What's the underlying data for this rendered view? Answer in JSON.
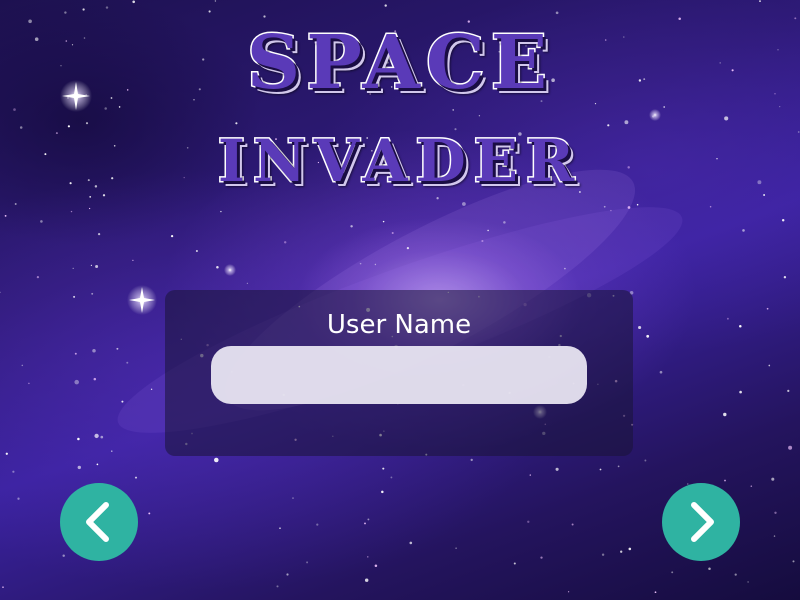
{
  "game": {
    "title_line1": "SPACE",
    "title_line2": "INVADER"
  },
  "login": {
    "label": "User Name",
    "value": "",
    "placeholder": ""
  },
  "nav": {
    "prev_icon": "chevron-left-icon",
    "next_icon": "chevron-right-icon"
  },
  "colors": {
    "background": "#2e1a78",
    "title_fill": "#5a3ab8",
    "panel": "#191437",
    "input": "#ece8f4",
    "accent": "#2fb3a2"
  }
}
